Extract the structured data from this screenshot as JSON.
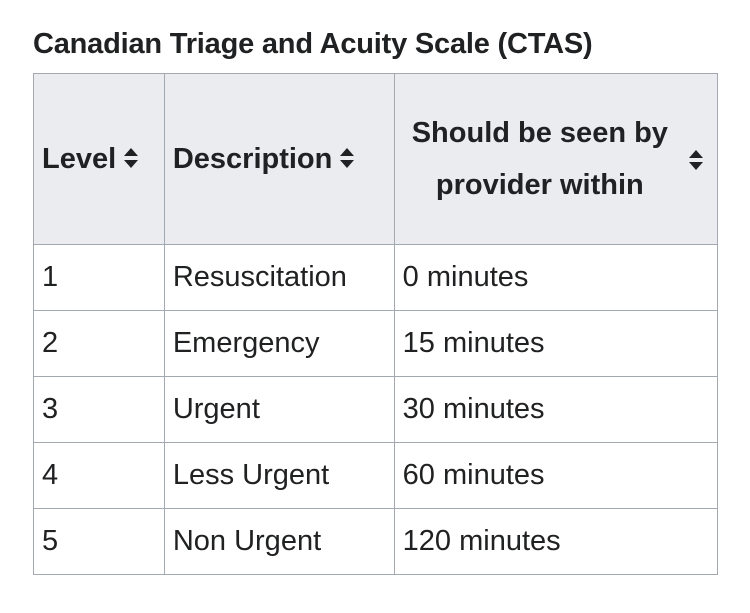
{
  "caption": "Canadian Triage and Acuity Scale (CTAS)",
  "headers": [
    {
      "label": "Level",
      "icon": "sort-icon"
    },
    {
      "label": "Description",
      "icon": "sort-icon"
    },
    {
      "label": "Should be seen by provider within",
      "icon": "sort-icon"
    }
  ],
  "rows": [
    {
      "level": "1",
      "description": "Resuscitation",
      "time": "0 minutes"
    },
    {
      "level": "2",
      "description": "Emergency",
      "time": "15 minutes"
    },
    {
      "level": "3",
      "description": "Urgent",
      "time": "30 minutes"
    },
    {
      "level": "4",
      "description": "Less Urgent",
      "time": "60 minutes"
    },
    {
      "level": "5",
      "description": "Non Urgent",
      "time": "120 minutes"
    }
  ]
}
